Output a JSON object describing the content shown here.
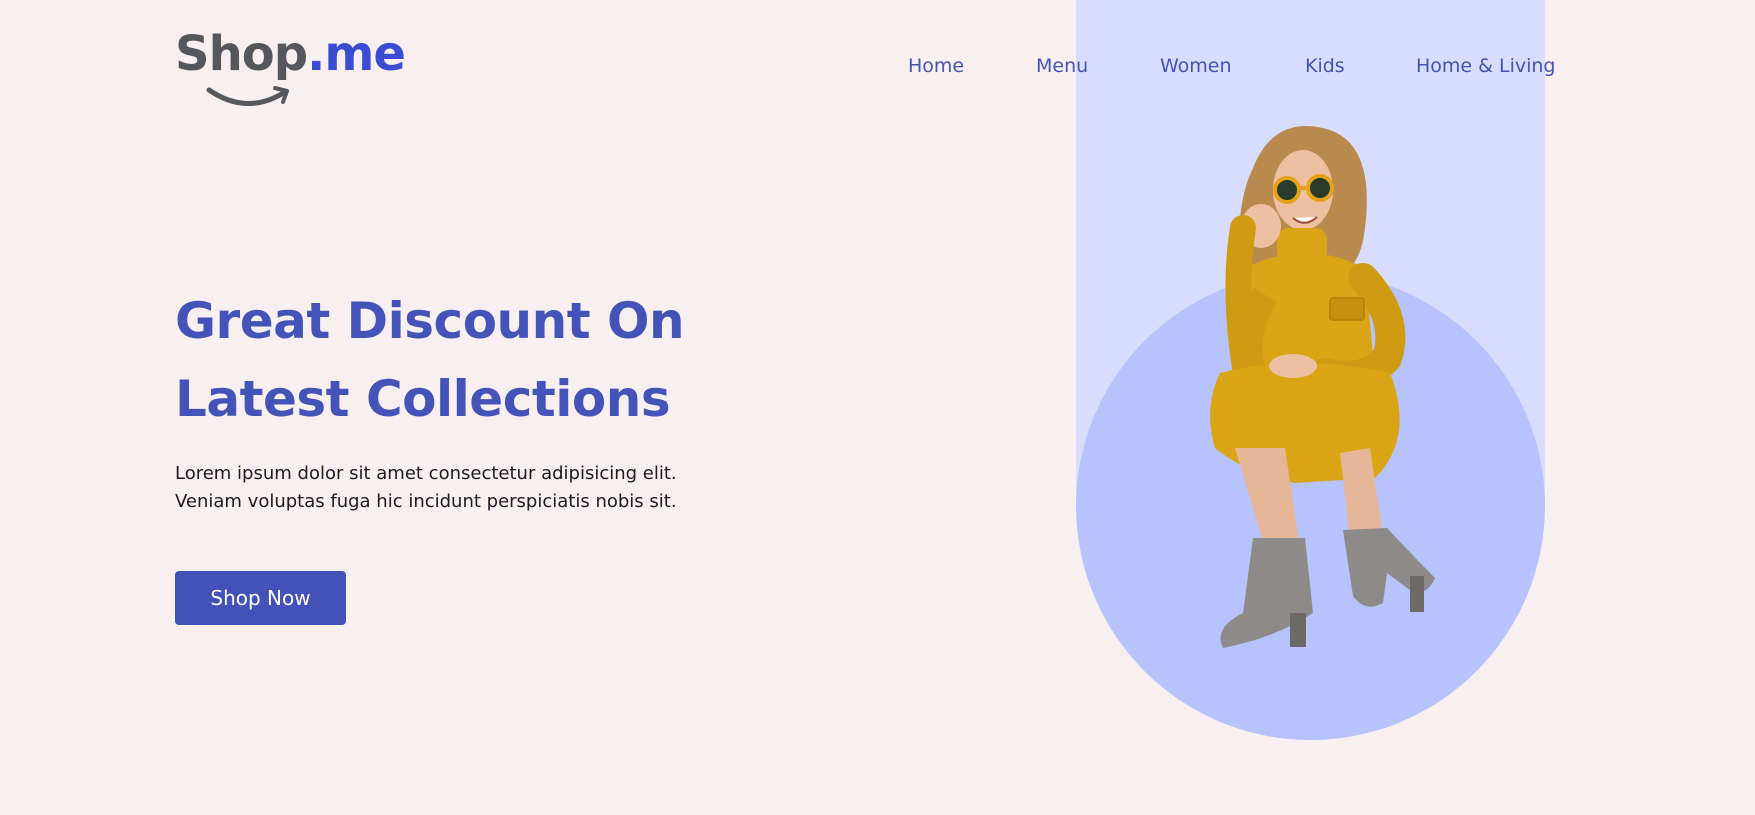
{
  "brand": {
    "name_part1": "Shop",
    "name_part2": ".me",
    "color_dark": "#55575c",
    "color_accent": "#3b4bd2"
  },
  "nav": {
    "items": [
      {
        "label": "Home"
      },
      {
        "label": "Menu"
      },
      {
        "label": "Women"
      },
      {
        "label": "Kids"
      },
      {
        "label": "Home & Living"
      }
    ]
  },
  "hero": {
    "headline": "Great Discount On Latest Collections",
    "description_line1": "Lorem ipsum dolor sit amet consectetur adipisicing elit.",
    "description_line2": "Veniam voluptas fuga hic incidunt perspiciatis nobis sit.",
    "cta_label": "Shop Now",
    "image_subject": "woman in mustard yellow knit dress, sunglasses and grey ankle boots crouching"
  },
  "colors": {
    "background": "#f8eff0",
    "accent": "#4352b8",
    "panel_light": "#d8ddfd",
    "panel_circle": "#b7c3fd",
    "dress": "#d9a514"
  }
}
